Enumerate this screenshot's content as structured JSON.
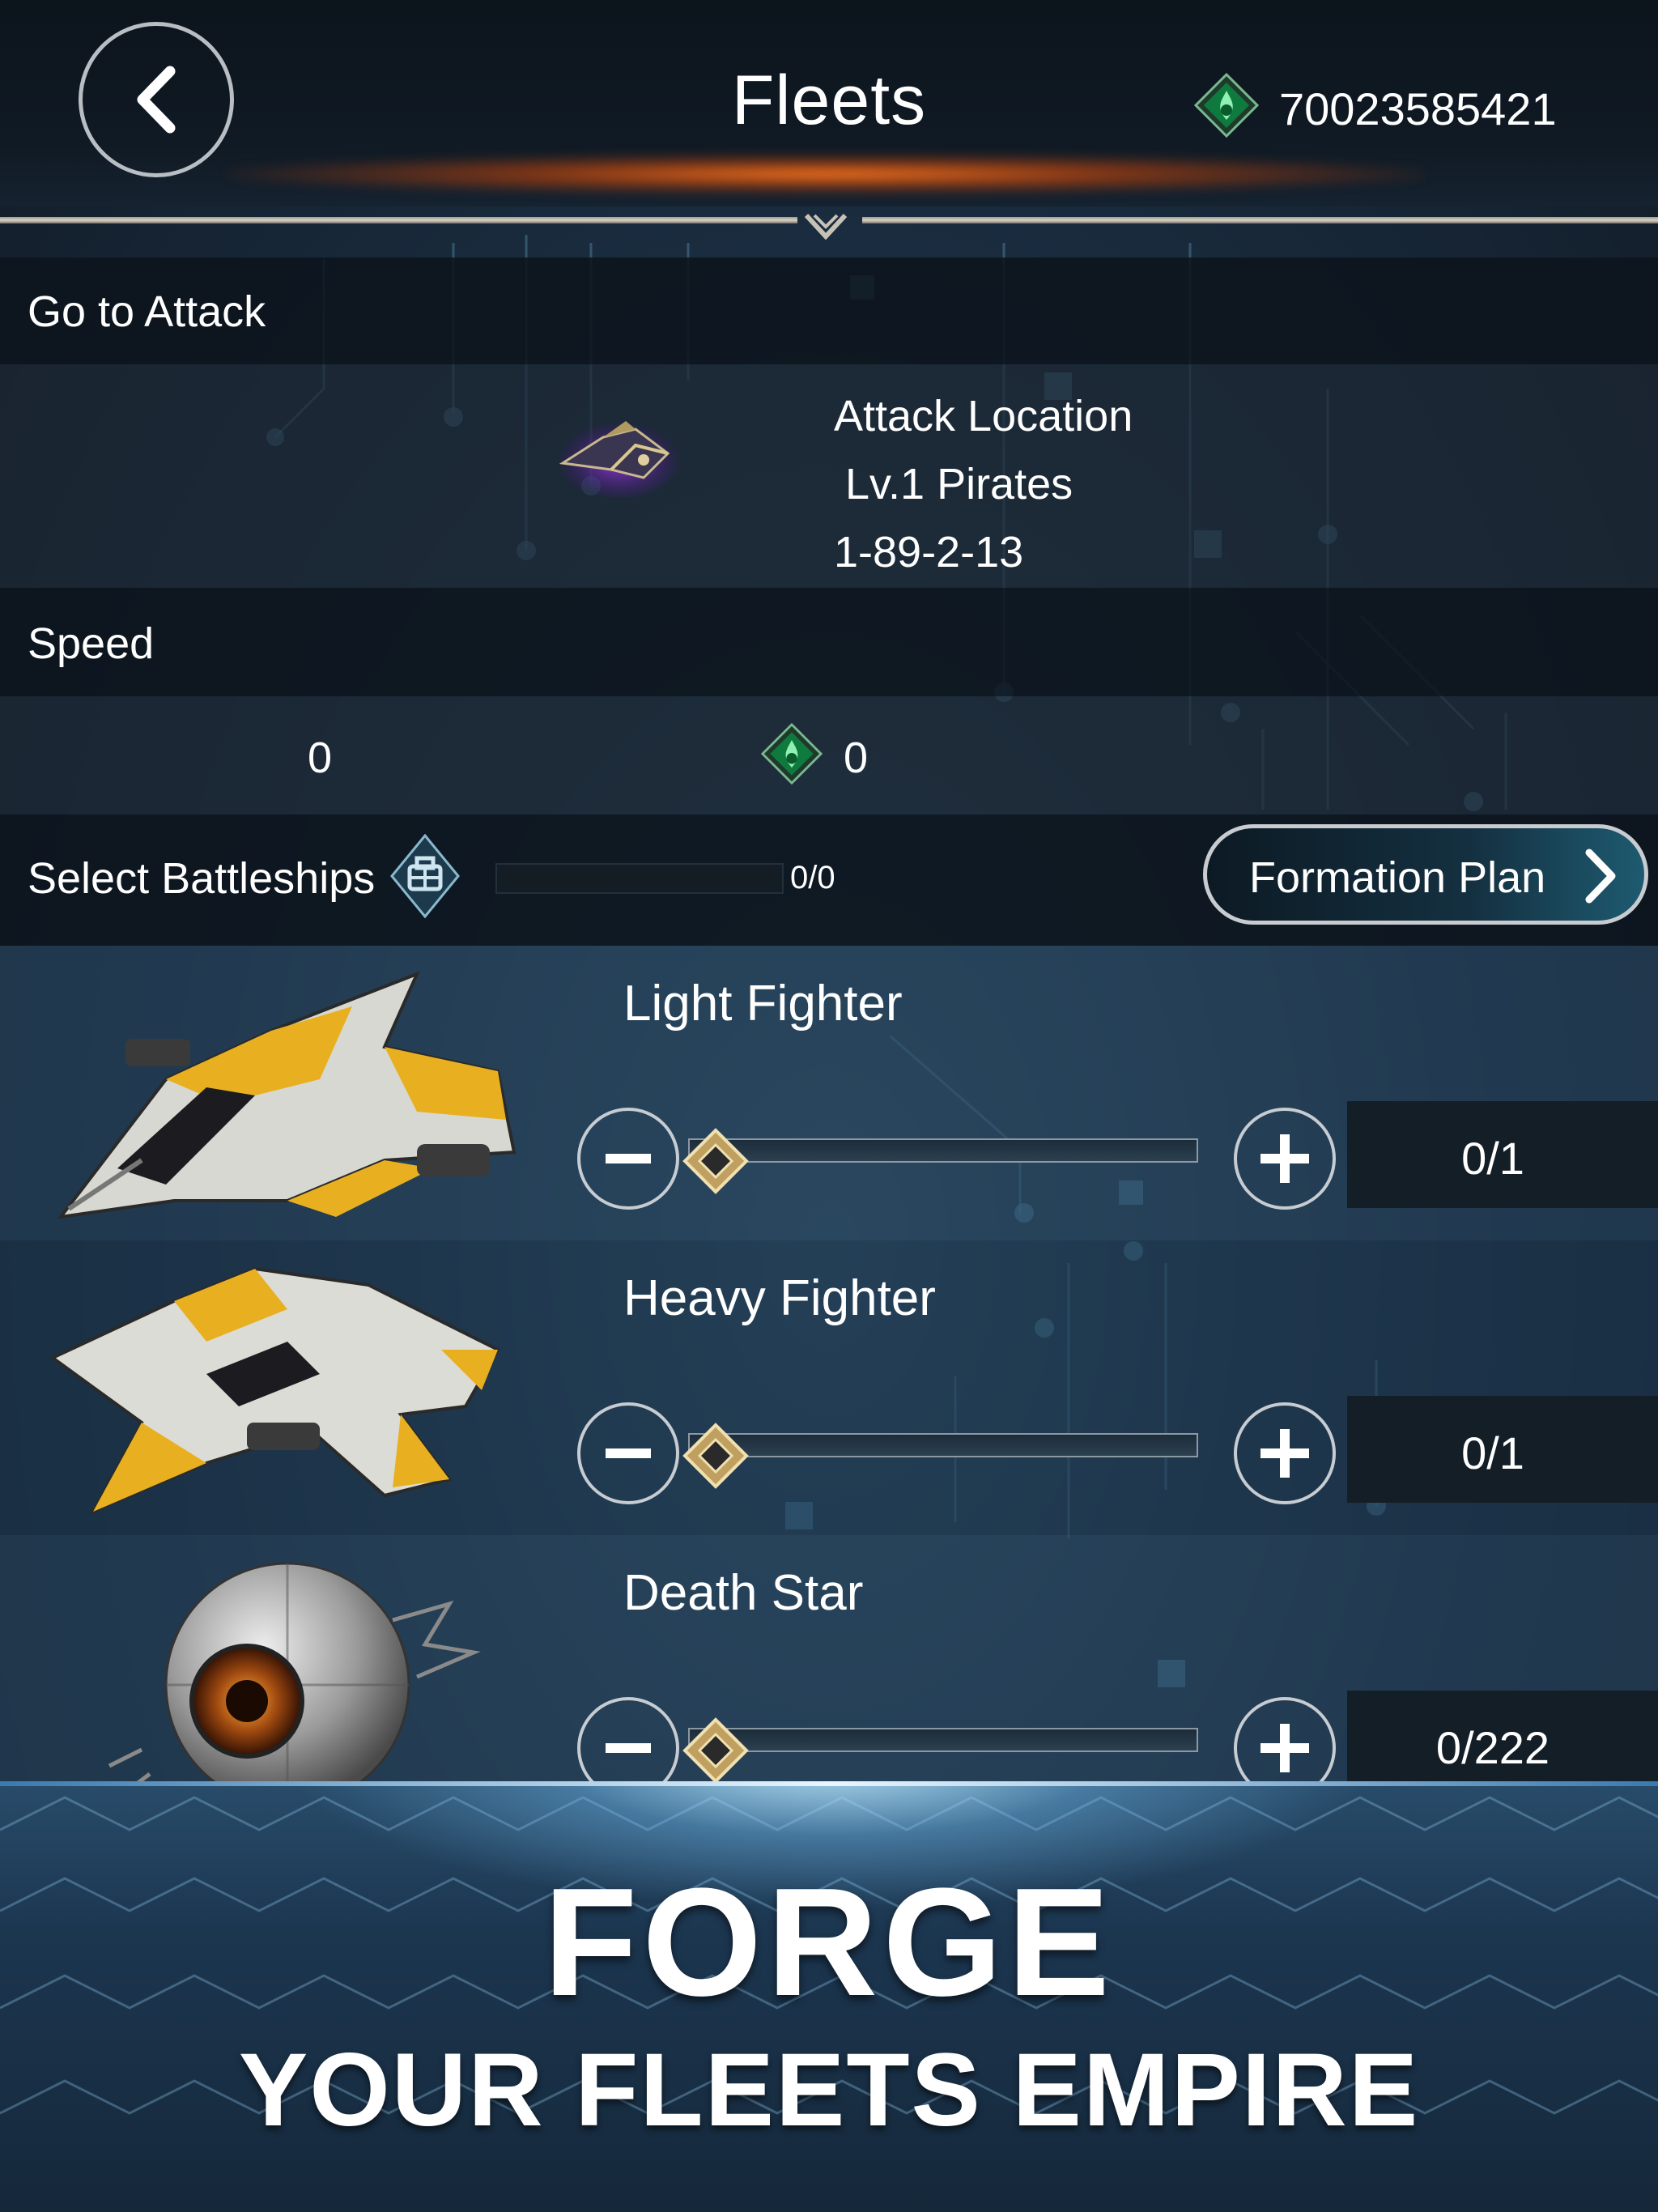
{
  "header": {
    "title": "Fleets",
    "currency_amount": "70023585421",
    "back_icon": "chevron-left-icon",
    "currency_icon": "green-gem-icon"
  },
  "attack": {
    "section_label": "Go to Attack",
    "location_title": "Attack Location",
    "target_name": "Lv.1 Pirates",
    "coordinates": "1-89-2-13"
  },
  "speed": {
    "section_label": "Speed",
    "left_value": "0",
    "gem_value": "0"
  },
  "battleships": {
    "label": "Select Battleships",
    "count": "0/0",
    "formation_button": "Formation Plan"
  },
  "ships": [
    {
      "name": "Light Fighter",
      "quantity": "0/1",
      "slider_value": 0
    },
    {
      "name": "Heavy Fighter",
      "quantity": "0/1",
      "slider_value": 0
    },
    {
      "name": "Death Star",
      "quantity": "0/222",
      "slider_value": 0
    }
  ],
  "banner": {
    "headline": "FORGE",
    "subline": "YOUR FLEETS EMPIRE"
  },
  "colors": {
    "accent_orange": "#e86a1a",
    "gem_green": "#1fc46a",
    "banner_blue": "#284c6a"
  }
}
